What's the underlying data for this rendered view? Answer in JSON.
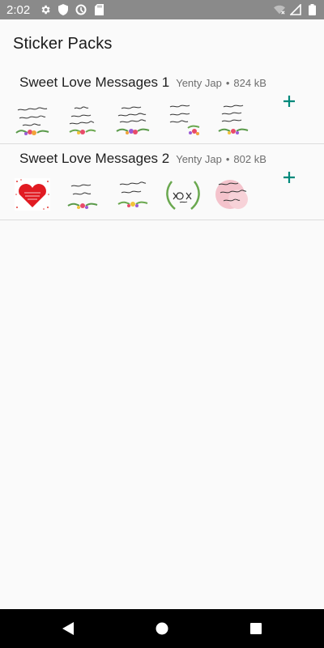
{
  "status_bar": {
    "time": "2:02",
    "left_icons": [
      "gear-icon",
      "shield-icon",
      "sync-icon",
      "sd-card-icon"
    ],
    "right_icons": [
      "wifi-icon",
      "signal-icon",
      "battery-icon"
    ]
  },
  "app_bar": {
    "title": "Sticker Packs"
  },
  "packs": [
    {
      "title": "Sweet Love Messages 1",
      "author": "Yenty Jap",
      "separator": "•",
      "size": "824 kB",
      "stickers": [
        "thank-you-for-being-in-my-life",
        "be-my-valentine",
        "you-have-my-whole-heart",
        "my-heart-is-wherever-you-are",
        "your-smile-lights-up-my-life"
      ]
    },
    {
      "title": "Sweet Love Messages 2",
      "author": "Yenty Jap",
      "separator": "•",
      "size": "802 kB",
      "stickers": [
        "red-heart-love-message",
        "sending-hugs",
        "you-are-my-magic",
        "xoxo-day",
        "my-life-is-beautiful-with-you"
      ]
    }
  ],
  "colors": {
    "accent": "#00897b",
    "status_bar": "#8a8a8a",
    "nav_bar": "#000000",
    "background": "#fafafa"
  },
  "nav_bar": {
    "buttons": [
      "back-icon",
      "home-icon",
      "recents-icon"
    ]
  }
}
